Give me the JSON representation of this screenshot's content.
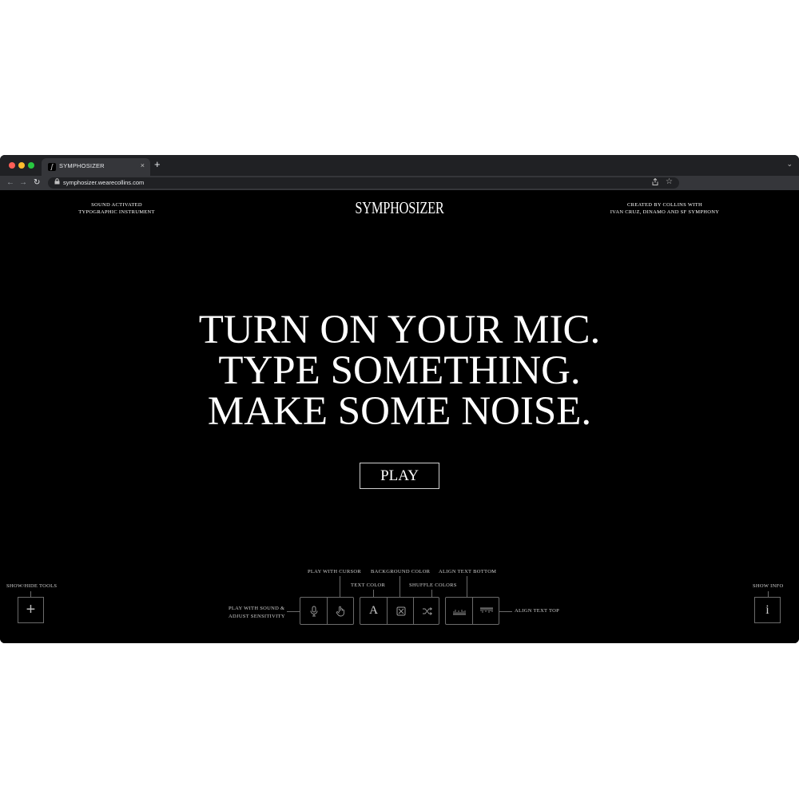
{
  "browser": {
    "tab_title": "SYMPHOSIZER",
    "tab_favicon": "ʃ",
    "tab_close": "×",
    "new_tab": "+",
    "tab_menu": "⌄",
    "url": "symphosizer.wearecollins.com",
    "icons": [
      "back-icon",
      "forward-icon",
      "reload-icon",
      "lock-icon",
      "share-icon",
      "bookmark-star-icon"
    ]
  },
  "header": {
    "left_line1": "SOUND ACTIVATED",
    "left_line2": "TYPOGRAPHIC INSTRUMENT",
    "logo": "SYMPHOSIZER",
    "right_line1": "CREATED BY COLLINS WITH",
    "right_line2": "IVAN CRUZ, DINAMO AND SF SYMPHONY"
  },
  "main": {
    "headline_line1": "TURN ON YOUR MIC.",
    "headline_line2": "TYPE SOMETHING.",
    "headline_line3": "MAKE SOME NOISE.",
    "play_label": "PLAY"
  },
  "tools": {
    "show_hide_label": "SHOW/HIDE TOOLS",
    "show_hide_glyph": "+",
    "sound_label_line1": "PLAY WITH SOUND &",
    "sound_label_line2": "ADJUST SENSITIVITY",
    "cursor_label": "PLAY WITH CURSOR",
    "text_color_label": "TEXT COLOR",
    "text_color_glyph": "A",
    "background_color_label": "BACKGROUND COLOR",
    "shuffle_colors_label": "SHUFFLE COLORS",
    "align_bottom_label": "ALIGN TEXT BOTTOM",
    "align_top_label": "ALIGN TEXT TOP",
    "show_info_label": "SHOW INFO",
    "show_info_glyph": "i"
  },
  "colors": {
    "background": "#000000",
    "text": "#ffffff",
    "border": "#6b6b6b",
    "browser_chrome": "#202124"
  }
}
